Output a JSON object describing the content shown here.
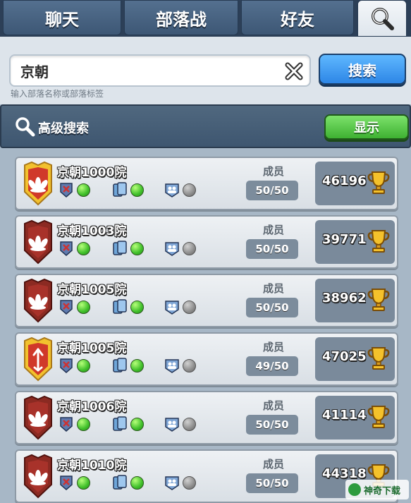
{
  "tabs": [
    {
      "label": "聊天"
    },
    {
      "label": "部落战"
    },
    {
      "label": "好友"
    },
    {
      "icon": "search-icon",
      "active": true
    }
  ],
  "search": {
    "value": "京朝",
    "button_label": "搜索",
    "hint": "输入部落名称或部落标签"
  },
  "advanced": {
    "title": "高级搜索",
    "show_label": "显示"
  },
  "clans": [
    {
      "name": "京朝1000院",
      "members_label": "成员",
      "members": "50/50",
      "trophies": "46196",
      "badge": "gold-lotus",
      "status": [
        "green",
        "green",
        "grey"
      ]
    },
    {
      "name": "京朝1003院",
      "members_label": "成员",
      "members": "50/50",
      "trophies": "39771",
      "badge": "red-lotus",
      "status": [
        "green",
        "green",
        "grey"
      ]
    },
    {
      "name": "京朝1005院",
      "members_label": "成员",
      "members": "50/50",
      "trophies": "38962",
      "badge": "red-lotus",
      "status": [
        "green",
        "green",
        "grey"
      ]
    },
    {
      "name": "京朝1005院",
      "members_label": "成员",
      "members": "49/50",
      "trophies": "47025",
      "badge": "gold-arrow",
      "status": [
        "green",
        "green",
        "grey"
      ]
    },
    {
      "name": "京朝1006院",
      "members_label": "成员",
      "members": "50/50",
      "trophies": "41114",
      "badge": "red-lotus",
      "status": [
        "green",
        "green",
        "grey"
      ]
    },
    {
      "name": "京朝1010院",
      "members_label": "成员",
      "members": "50/50",
      "trophies": "44318",
      "badge": "red-lotus",
      "status": [
        "green",
        "green",
        "grey"
      ]
    }
  ],
  "watermark": "神奇下载",
  "colors": {
    "tab_bar": "#2c3f57",
    "search_button": "#2d86e6",
    "show_button": "#3eb132",
    "list_bg": "#a7b7c6"
  }
}
